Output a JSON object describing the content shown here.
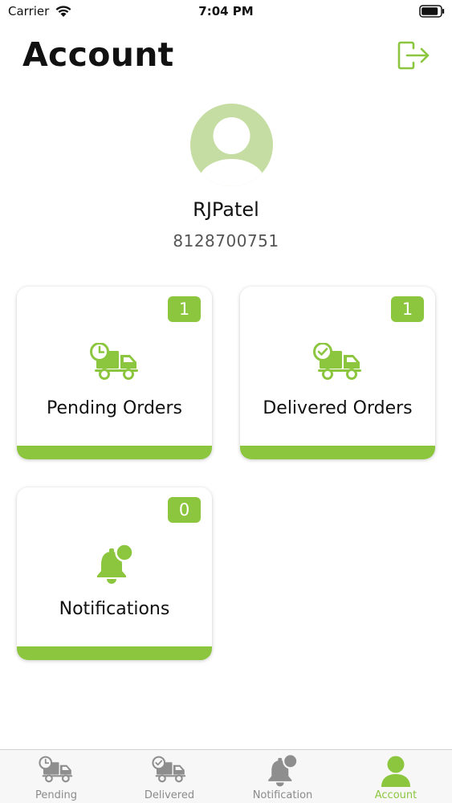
{
  "status_bar": {
    "carrier": "Carrier",
    "time": "7:04 PM",
    "wifi_icon": "wifi-icon",
    "battery_icon": "battery-icon"
  },
  "header": {
    "title": "Account",
    "logout_icon": "logout-icon"
  },
  "profile": {
    "avatar_icon": "user-avatar-icon",
    "name": "RJPatel",
    "phone": "8128700751"
  },
  "cards": [
    {
      "label": "Pending Orders",
      "badge": "1",
      "icon": "truck-clock-icon"
    },
    {
      "label": "Delivered Orders",
      "badge": "1",
      "icon": "truck-check-icon"
    },
    {
      "label": "Notifications",
      "badge": "0",
      "icon": "bell-icon"
    }
  ],
  "tab_bar": {
    "tabs": [
      {
        "label": "Pending",
        "icon": "truck-clock-icon",
        "active": false
      },
      {
        "label": "Delivered",
        "icon": "truck-check-icon",
        "active": false
      },
      {
        "label": "Notification",
        "icon": "bell-icon",
        "active": false
      },
      {
        "label": "Account",
        "icon": "user-icon",
        "active": true
      }
    ]
  },
  "colors": {
    "accent": "#8cc63f",
    "avatar_bg": "#c5dda2",
    "inactive_tab": "#8b8b8b"
  }
}
